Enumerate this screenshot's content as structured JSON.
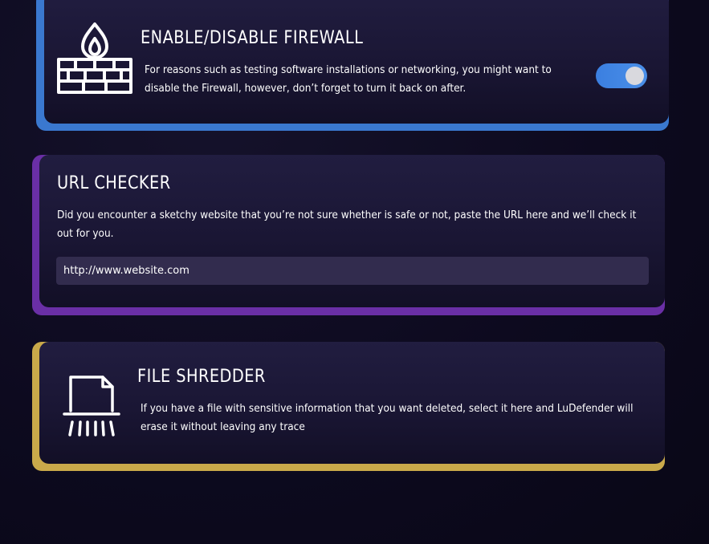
{
  "firewall": {
    "title": "ENABLE/DISABLE FIREWALL",
    "description": "For reasons such as testing software installations or networking, you might want to disable the Firewall, however, don’t forget to turn it back on after.",
    "icon": "firewall-icon",
    "toggle_on": true,
    "accent_color": "#3a78cf"
  },
  "url_checker": {
    "title": "URL CHECKER",
    "description": "Did you encounter a sketchy website that you’re not sure whether is safe or not, paste the URL here and we’ll check it out for you.",
    "input_placeholder": "http://www.website.com",
    "accent_color": "#6a2fa6"
  },
  "file_shredder": {
    "title": "FILE SHREDDER",
    "description": "If you have a file with sensitive information that you want deleted, select it here and LuDefender will erase it without leaving any trace",
    "icon": "shredder-icon",
    "accent_color": "#c9a94a"
  }
}
